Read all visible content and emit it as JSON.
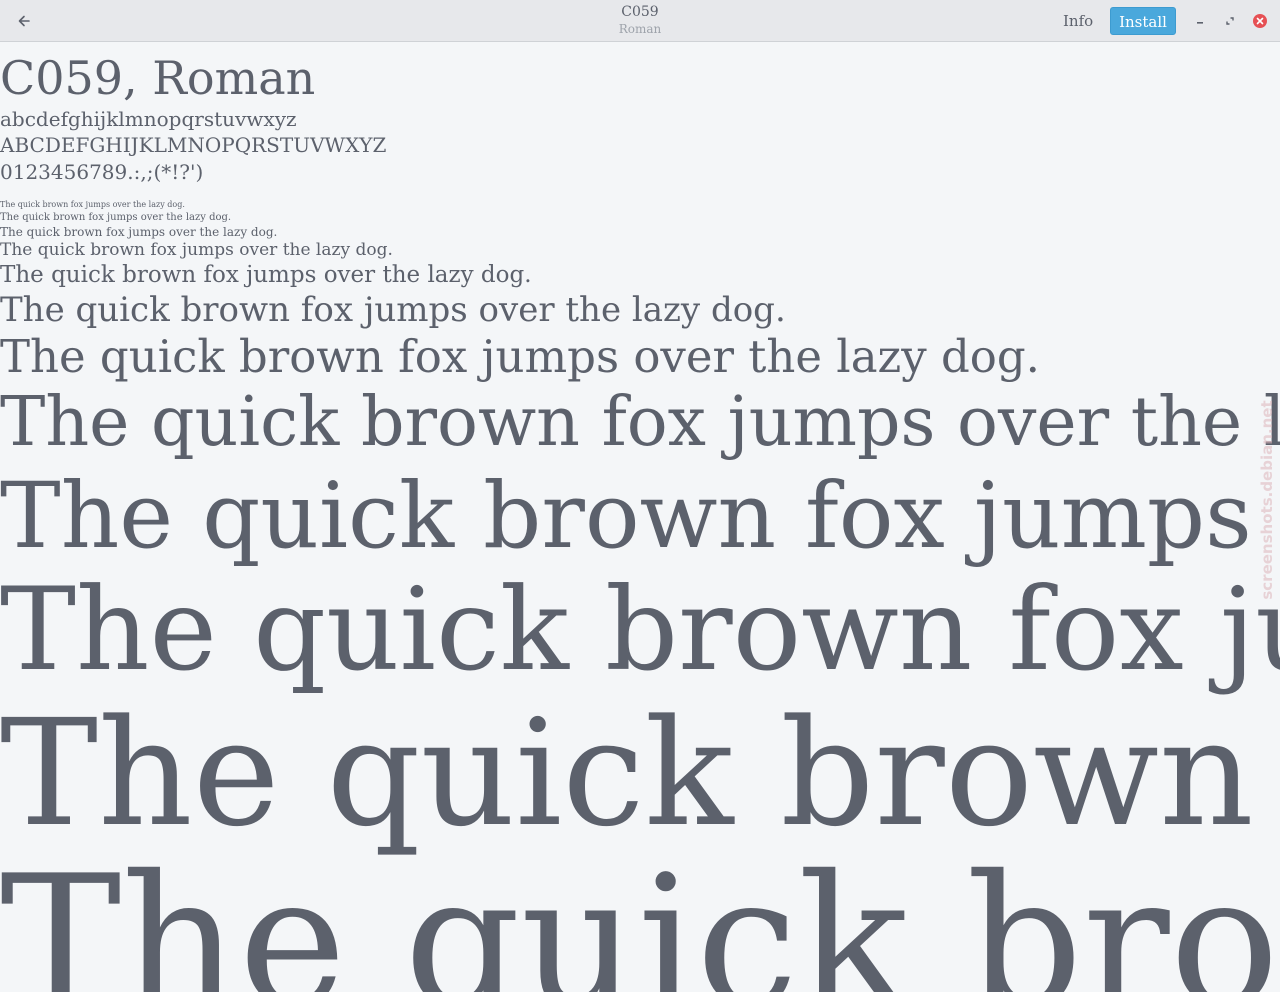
{
  "header": {
    "title": "C059",
    "subtitle": "Roman",
    "info_label": "Info",
    "install_label": "Install",
    "back_icon": "arrow-left-icon",
    "minimize_icon": "minimize-icon",
    "maximize_icon": "maximize-icon",
    "close_icon": "close-icon"
  },
  "preview": {
    "heading": "C059, Roman",
    "lowercase": "abcdefghijklmnopqrstuvwxyz",
    "uppercase": "ABCDEFGHIJKLMNOPQRSTUVWXYZ",
    "digits": "0123456789.:,;(*!?')",
    "sample": "The quick brown fox jumps over the lazy dog."
  },
  "watermark": "screenshots.debian.net",
  "colors": {
    "accent": "#4aa8dc",
    "close": "#e65054",
    "text": "#5c616c",
    "background": "#f4f6f8",
    "headerbar": "#e7e8eb"
  }
}
